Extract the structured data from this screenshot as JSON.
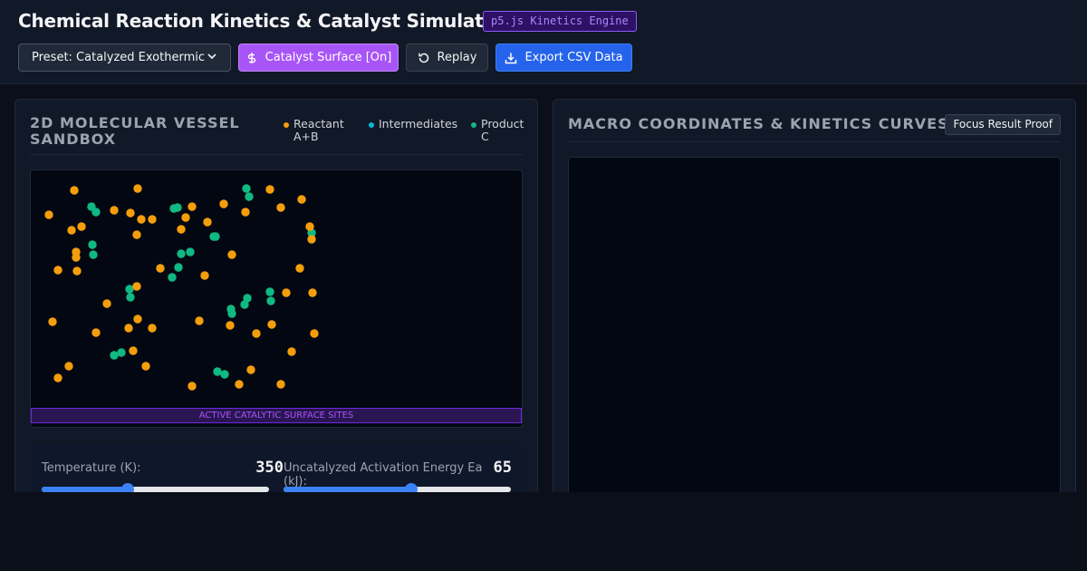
{
  "app": {
    "title": "Chemical Reaction Kinetics & Catalyst Simulator",
    "engine_badge": "p5.js Kinetics Engine"
  },
  "toolbar": {
    "preset_value": "Preset: Catalyzed Exothermic",
    "catalyst_label": "Catalyst Surface [On]",
    "replay_label": "Replay",
    "export_label": "Export CSV Data"
  },
  "vessel_panel": {
    "title": "2D MOLECULAR VESSEL SANDBOX",
    "legend": [
      {
        "label": "Reactant A+B",
        "color": "#f59e0b"
      },
      {
        "label": "Intermediates",
        "color": "#06b6d4"
      },
      {
        "label": "Product C",
        "color": "#10b981"
      }
    ],
    "catalyst_surface_label": "ACTIVE CATALYTIC SURFACE SITES"
  },
  "controls": {
    "temperature": {
      "label": "Temperature (K):",
      "value": "350",
      "fraction": 0.38
    },
    "activation_energy": {
      "label": "Uncatalyzed Activation Energy Ea (kJ):",
      "value": "65",
      "fraction": 0.56
    }
  },
  "kinetics_panel": {
    "title": "MACRO COORDINATES & KINETICS CURVES",
    "focus_button": "Focus Result Proof"
  },
  "colors": {
    "reactant": "#f59e0b",
    "intermediate": "#06b6d4",
    "product": "#10b981",
    "accent_purple": "#a855f7",
    "accent_blue": "#2563eb"
  }
}
